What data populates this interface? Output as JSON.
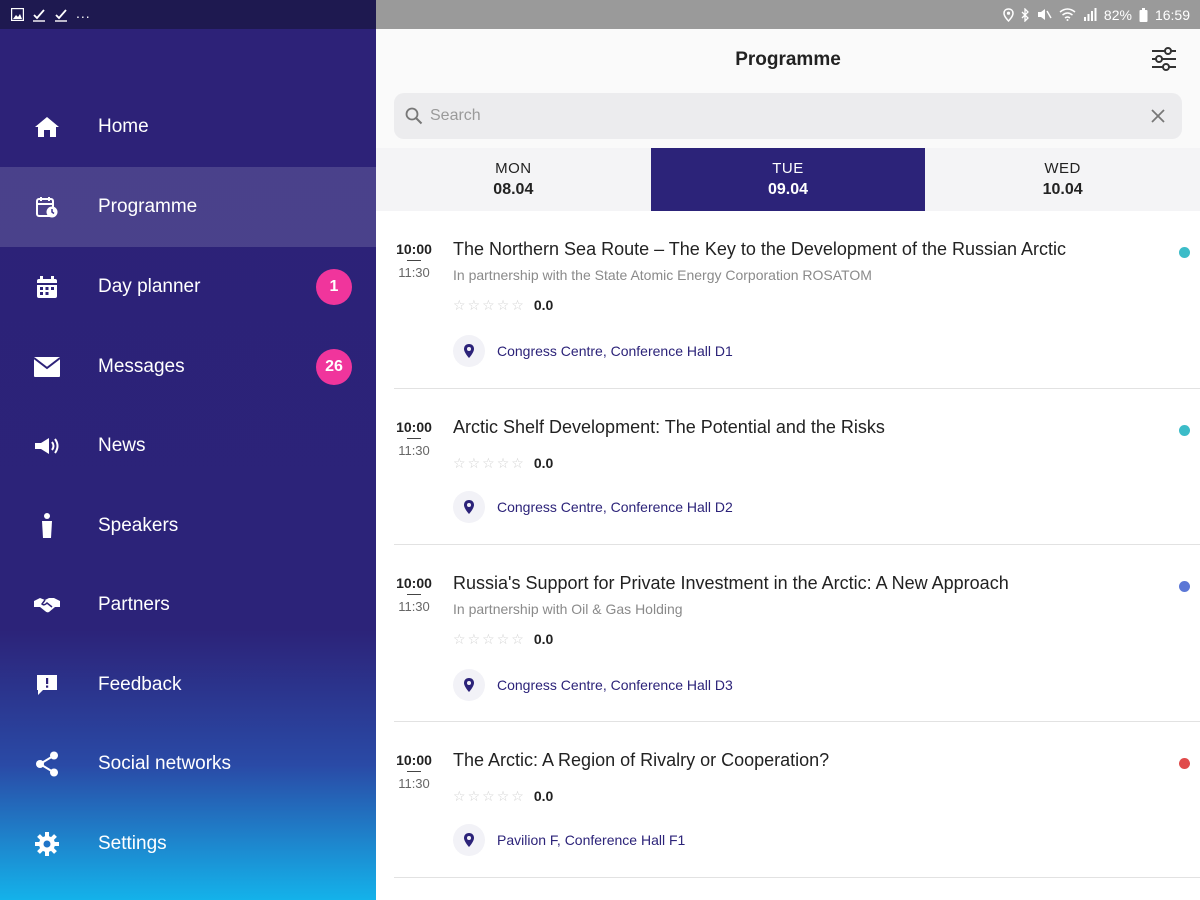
{
  "sidebar": {
    "status_dots": "...",
    "items": [
      {
        "label": "Home",
        "icon": "home-icon"
      },
      {
        "label": "Programme",
        "icon": "calendar-clock-icon",
        "active": true
      },
      {
        "label": "Day planner",
        "icon": "calendar-icon",
        "badge": "1"
      },
      {
        "label": "Messages",
        "icon": "envelope-icon",
        "badge": "26"
      },
      {
        "label": "News",
        "icon": "megaphone-icon"
      },
      {
        "label": "Speakers",
        "icon": "microphone-icon"
      },
      {
        "label": "Partners",
        "icon": "handshake-icon"
      },
      {
        "label": "Feedback",
        "icon": "feedback-icon"
      },
      {
        "label": "Social networks",
        "icon": "share-icon"
      },
      {
        "label": "Settings",
        "icon": "gear-icon"
      }
    ]
  },
  "status_bar": {
    "battery": "82%",
    "time": "16:59"
  },
  "header": {
    "title": "Programme"
  },
  "search": {
    "placeholder": "Search",
    "value": ""
  },
  "day_tabs": [
    {
      "day": "MON",
      "date": "08.04"
    },
    {
      "day": "TUE",
      "date": "09.04",
      "active": true
    },
    {
      "day": "WED",
      "date": "10.04"
    }
  ],
  "sessions": [
    {
      "start": "10:00",
      "end": "11:30",
      "title": "The Northern Sea Route – The Key to the Development of the Russian Arctic",
      "subtitle": "In partnership with the State Atomic Energy Corporation ROSATOM",
      "rating": "0.0",
      "location": "Congress Centre, Conference Hall D1",
      "dot_color": "#3cbcc8"
    },
    {
      "start": "10:00",
      "end": "11:30",
      "title": "Arctic Shelf Development: The Potential and the Risks",
      "subtitle": "",
      "rating": "0.0",
      "location": "Congress Centre, Conference Hall D2",
      "dot_color": "#3cbcc8"
    },
    {
      "start": "10:00",
      "end": "11:30",
      "title": "Russia's Support for Private Investment in the Arctic: A New Approach",
      "subtitle": "In partnership with Oil & Gas Holding",
      "rating": "0.0",
      "location": "Congress Centre, Conference Hall D3",
      "dot_color": "#5b77d6"
    },
    {
      "start": "10:00",
      "end": "11:30",
      "title": "The Arctic: A Region of Rivalry or Cooperation?",
      "subtitle": "",
      "rating": "0.0",
      "location": "Pavilion F, Conference Hall F1",
      "dot_color": "#e04a4a"
    }
  ],
  "colors": {
    "primary": "#2c2379",
    "badge": "#f0359c",
    "gradient_end": "#14b2ea"
  }
}
